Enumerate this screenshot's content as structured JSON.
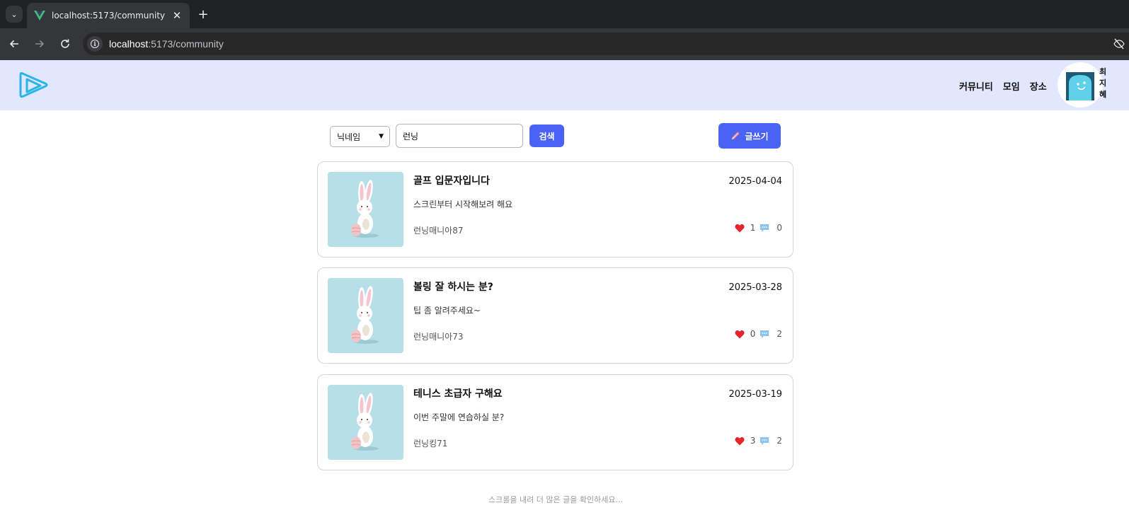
{
  "browser": {
    "tab_title": "localhost:5173/community",
    "url_host": "localhost",
    "url_path": ":5173/community"
  },
  "header": {
    "nav": [
      "커뮤니티",
      "모임",
      "장소"
    ],
    "profile_name": [
      "최",
      "지",
      "혜"
    ]
  },
  "search": {
    "select_value": "닉네임",
    "query": "런닝",
    "search_label": "검색",
    "write_label": "글쓰기"
  },
  "posts": [
    {
      "title": "골프 입문자입니다",
      "date": "2025-04-04",
      "summary": "스크린부터 시작해보려 해요",
      "author": "런닝매니아87",
      "likes": "1",
      "comments": "0"
    },
    {
      "title": "볼링 잘 하시는 분?",
      "date": "2025-03-28",
      "summary": "팁 좀 알려주세요~",
      "author": "런닝매니아73",
      "likes": "0",
      "comments": "2"
    },
    {
      "title": "테니스 초급자 구해요",
      "date": "2025-03-19",
      "summary": "이번 주말에 연습하실 분?",
      "author": "런닝킹71",
      "likes": "3",
      "comments": "2"
    }
  ],
  "scroll_hint": "스크롤을 내려 더 많은 글을 확인하세요...",
  "colors": {
    "header_bg": "#e1e7fd",
    "primary_button": "#4a63f5",
    "heart": "#e5252a",
    "thumb_bg": "#b6dfe8"
  }
}
